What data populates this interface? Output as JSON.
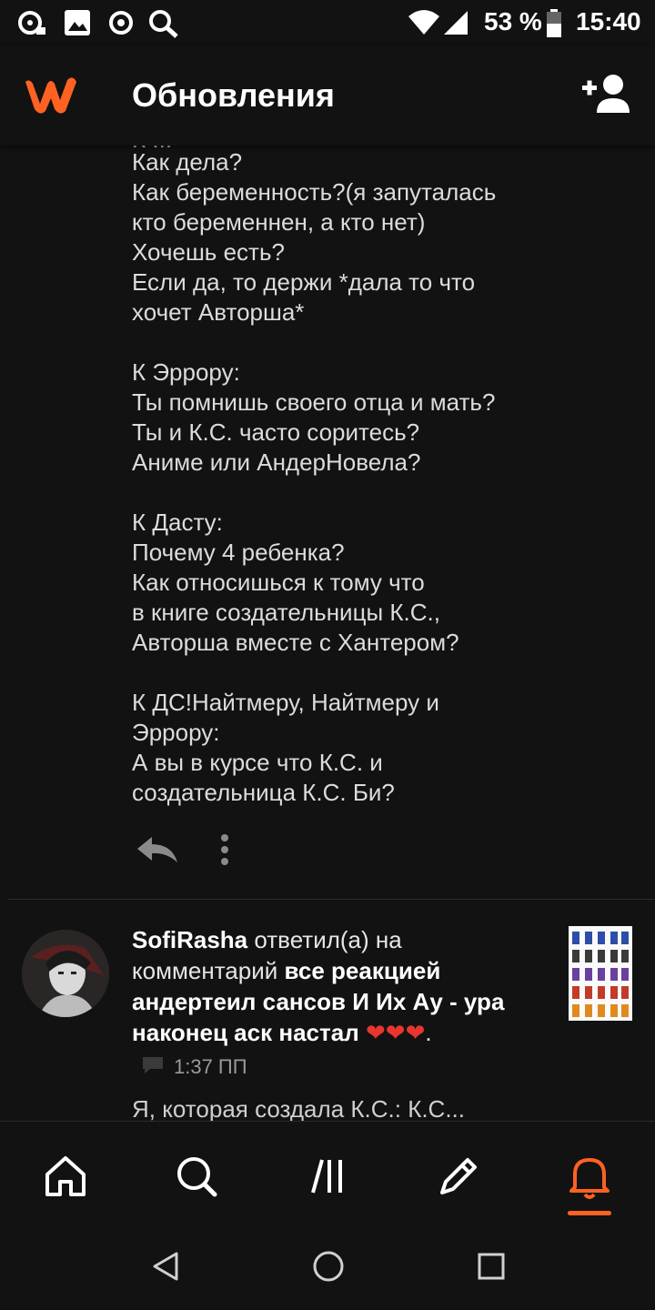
{
  "status_bar": {
    "battery": "53 %",
    "time": "15:40",
    "icons": [
      "sync-icon",
      "image-icon",
      "record-icon",
      "search-icon",
      "wifi-icon",
      "signal-icon",
      "battery-icon"
    ]
  },
  "app_bar": {
    "title": "Обновления",
    "logo": "wattpad-logo-icon",
    "action": "add-user-icon"
  },
  "message": {
    "cut_top_line": "К ...",
    "body": "Как дела?\nКак беременность?(я запуталась\nкто беременнен, а кто нет)\nХочешь есть?\nЕсли да, то держи *дала то что\nхочет Авторша*\n\nК Эррору:\nТы помнишь своего отца и мать?\nТы и К.С. часто соритесь?\nАниме или АндерНовела?\n\nК Дасту:\nПочему 4 ребенка?\nКак относишься к тому что\nв книге создательницы К.С.,\nАвторша вместе с Хантером?\n\nК ДС!Найтмеру, Найтмеру и\nЭррору:\nА вы в курсе что К.С. и\nсоздательница К.С. Би?"
  },
  "notification": {
    "user": "SofiRasha",
    "action_text": " ответил(а) на комментарий ",
    "story_title": "все реакцией андертеил сансов И Их Ау - ура наконец аск настал ❤❤❤",
    "trailing": ".",
    "time": "1:37 ПП",
    "preview": "Я, которая создала К.С.: К.С..."
  },
  "bottom_nav": {
    "items": [
      "home-icon",
      "search-icon",
      "library-icon",
      "write-icon",
      "notifications-icon"
    ],
    "active": "notifications-icon"
  },
  "colors": {
    "accent": "#ff6122",
    "background": "#121212",
    "text": "#e6e6e6",
    "muted": "#9a9a9a",
    "heart": "#e8352f"
  }
}
